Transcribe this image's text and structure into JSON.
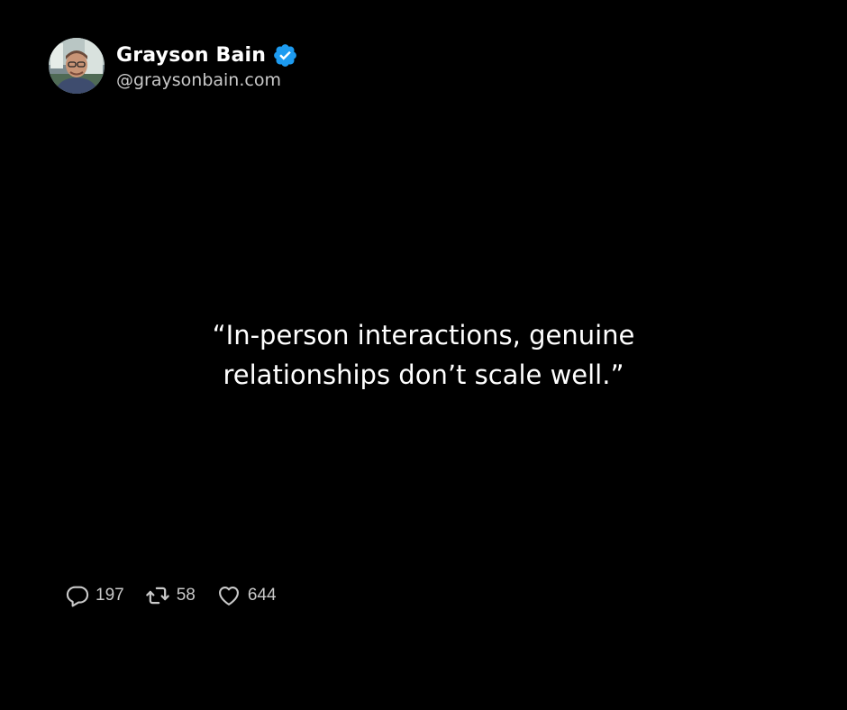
{
  "author": {
    "name": "Grayson Bain",
    "handle": "@graysonbain.com",
    "avatar_icon": "profile-photo",
    "verified_icon": "verified-badge-icon",
    "verified_color": "#1d9bf0"
  },
  "post": {
    "quote_line1": "“In-person interactions, genuine",
    "quote_line2": "relationships don’t scale well.”"
  },
  "stats": {
    "replies": "197",
    "reposts": "58",
    "likes": "644",
    "reply_icon": "reply-icon",
    "repost_icon": "repost-icon",
    "like_icon": "heart-icon"
  },
  "colors": {
    "background": "#000000",
    "text_primary": "#ffffff",
    "text_secondary": "#c9c9c9"
  }
}
